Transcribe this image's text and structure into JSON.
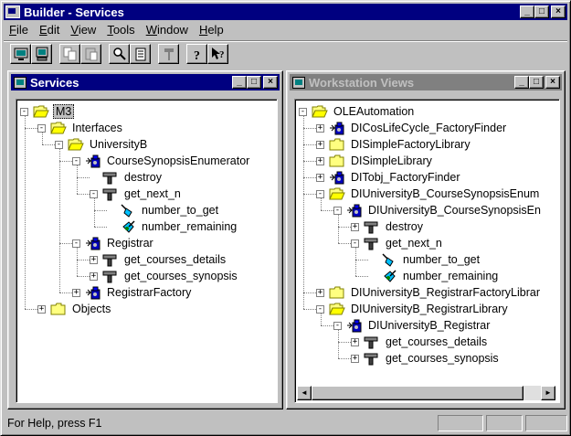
{
  "window": {
    "title": "Builder - Services",
    "min": "_",
    "max": "□",
    "close": "×"
  },
  "menu": [
    "File",
    "Edit",
    "View",
    "Tools",
    "Window",
    "Help"
  ],
  "toolbar": [
    "screen",
    "monitor",
    "copy",
    "paste",
    "find",
    "notepad",
    "hammer",
    "help",
    "context-help"
  ],
  "services": {
    "title": "Services",
    "nodes": [
      {
        "label": "M3",
        "icon": "folder-open",
        "exp": "-",
        "selected": true
      },
      {
        "label": "Interfaces",
        "icon": "folder-open",
        "exp": "-"
      },
      {
        "label": "UniversityB",
        "icon": "folder-open",
        "exp": "-"
      },
      {
        "label": "CourseSynopsisEnumerator",
        "icon": "interface",
        "exp": "-"
      },
      {
        "label": "destroy",
        "icon": "method",
        "exp": ""
      },
      {
        "label": "get_next_n",
        "icon": "method",
        "exp": "-"
      },
      {
        "label": "number_to_get",
        "icon": "param-in",
        "exp": ""
      },
      {
        "label": "number_remaining",
        "icon": "param-out",
        "exp": ""
      },
      {
        "label": "Registrar",
        "icon": "interface",
        "exp": "-"
      },
      {
        "label": "get_courses_details",
        "icon": "method",
        "exp": "+"
      },
      {
        "label": "get_courses_synopsis",
        "icon": "method",
        "exp": "+"
      },
      {
        "label": "RegistrarFactory",
        "icon": "interface",
        "exp": "+"
      },
      {
        "label": "Objects",
        "icon": "folder",
        "exp": "+"
      }
    ]
  },
  "workstation": {
    "title": "Workstation Views",
    "nodes": [
      {
        "label": "OLEAutomation",
        "icon": "folder-open",
        "exp": "-"
      },
      {
        "label": "DICosLifeCycle_FactoryFinder",
        "icon": "interface",
        "exp": "+"
      },
      {
        "label": "DISimpleFactoryLibrary",
        "icon": "folder",
        "exp": "+"
      },
      {
        "label": "DISimpleLibrary",
        "icon": "folder",
        "exp": "+"
      },
      {
        "label": "DITobj_FactoryFinder",
        "icon": "interface",
        "exp": "+"
      },
      {
        "label": "DIUniversityB_CourseSynopsisEnum",
        "icon": "folder-open",
        "exp": "-"
      },
      {
        "label": "DIUniversityB_CourseSynopsisEn",
        "icon": "interface",
        "exp": "-"
      },
      {
        "label": "destroy",
        "icon": "method",
        "exp": "+"
      },
      {
        "label": "get_next_n",
        "icon": "method",
        "exp": "-"
      },
      {
        "label": "number_to_get",
        "icon": "param-in",
        "exp": ""
      },
      {
        "label": "number_remaining",
        "icon": "param-out",
        "exp": ""
      },
      {
        "label": "DIUniversityB_RegistrarFactoryLibrar",
        "icon": "folder",
        "exp": "+"
      },
      {
        "label": "DIUniversityB_RegistrarLibrary",
        "icon": "folder-open",
        "exp": "-"
      },
      {
        "label": "DIUniversityB_Registrar",
        "icon": "interface",
        "exp": "-"
      },
      {
        "label": "get_courses_details",
        "icon": "method",
        "exp": "+"
      },
      {
        "label": "get_courses_synopsis",
        "icon": "method",
        "exp": "+"
      }
    ],
    "scroll_left": "◄",
    "scroll_right": "►"
  },
  "status": {
    "message": "For Help, press F1"
  }
}
